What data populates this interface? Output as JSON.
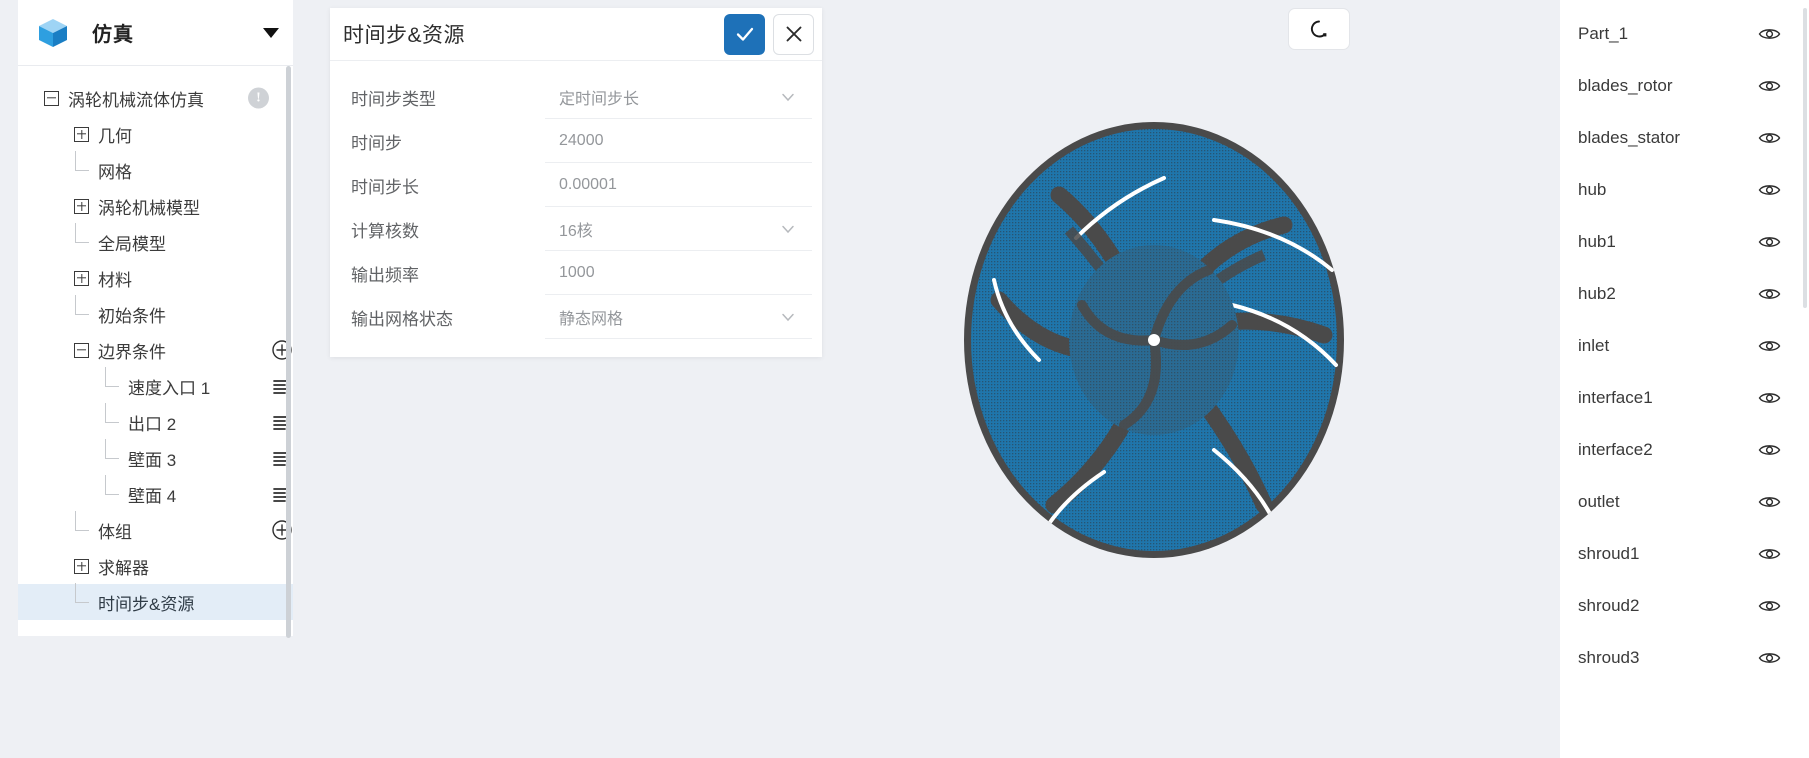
{
  "sidebar": {
    "app_title": "仿真",
    "app_icon": "cube-icon",
    "dropdown_icon": "caret-down-icon",
    "tree": [
      {
        "label": "涡轮机械流体仿真",
        "toggle": "minus",
        "indent": 0,
        "badge": "!",
        "action": ""
      },
      {
        "label": "几何",
        "toggle": "plus",
        "indent": 1,
        "action": ""
      },
      {
        "label": "网格",
        "toggle": "leaf",
        "indent": 1,
        "action": ""
      },
      {
        "label": "涡轮机械模型",
        "toggle": "plus",
        "indent": 1,
        "action": ""
      },
      {
        "label": "全局模型",
        "toggle": "leaf",
        "indent": 1,
        "action": ""
      },
      {
        "label": "材料",
        "toggle": "plus",
        "indent": 1,
        "action": ""
      },
      {
        "label": "初始条件",
        "toggle": "leaf",
        "indent": 1,
        "action": ""
      },
      {
        "label": "边界条件",
        "toggle": "minus",
        "indent": 1,
        "action": "plus-circle-icon"
      },
      {
        "label": "速度入口 1",
        "toggle": "leaf",
        "indent": 2,
        "action": "list-icon"
      },
      {
        "label": "出口 2",
        "toggle": "leaf",
        "indent": 2,
        "action": "list-icon"
      },
      {
        "label": "壁面 3",
        "toggle": "leaf",
        "indent": 2,
        "action": "list-icon"
      },
      {
        "label": "壁面 4",
        "toggle": "leaf",
        "indent": 2,
        "action": "list-icon"
      },
      {
        "label": "体组",
        "toggle": "leaf",
        "indent": 1,
        "action": "plus-circle-icon"
      },
      {
        "label": "求解器",
        "toggle": "plus",
        "indent": 1,
        "action": ""
      },
      {
        "label": "时间步&资源",
        "toggle": "leaf",
        "indent": 1,
        "action": "",
        "selected": true
      }
    ]
  },
  "panel": {
    "title": "时间步&资源",
    "confirm_icon": "check-icon",
    "cancel_icon": "close-icon",
    "confirm_color": "#1e71b8",
    "fields": [
      {
        "label": "时间步类型",
        "value": "定时间步长",
        "type": "select",
        "icon": "chevron-down-icon"
      },
      {
        "label": "时间步",
        "value": "24000",
        "type": "input"
      },
      {
        "label": "时间步长",
        "value": "0.00001",
        "type": "input"
      },
      {
        "label": "计算核数",
        "value": "16核",
        "type": "select",
        "icon": "chevron-down-icon"
      },
      {
        "label": "输出频率",
        "value": "1000",
        "type": "input"
      },
      {
        "label": "输出网格状态",
        "value": "静态网格",
        "type": "select",
        "icon": "chevron-down-icon"
      }
    ]
  },
  "viewport": {
    "refresh_icon": "refresh-icon",
    "mesh_color": "#1f76ac",
    "blade_color": "#4a4a4a",
    "background": "#eef0f4"
  },
  "parts": {
    "visibility_icon": "eye-icon",
    "items": [
      {
        "name": "Part_1"
      },
      {
        "name": "blades_rotor"
      },
      {
        "name": "blades_stator"
      },
      {
        "name": "hub"
      },
      {
        "name": "hub1"
      },
      {
        "name": "hub2"
      },
      {
        "name": "inlet"
      },
      {
        "name": "interface1"
      },
      {
        "name": "interface2"
      },
      {
        "name": "outlet"
      },
      {
        "name": "shroud1"
      },
      {
        "name": "shroud2"
      },
      {
        "name": "shroud3"
      }
    ]
  }
}
